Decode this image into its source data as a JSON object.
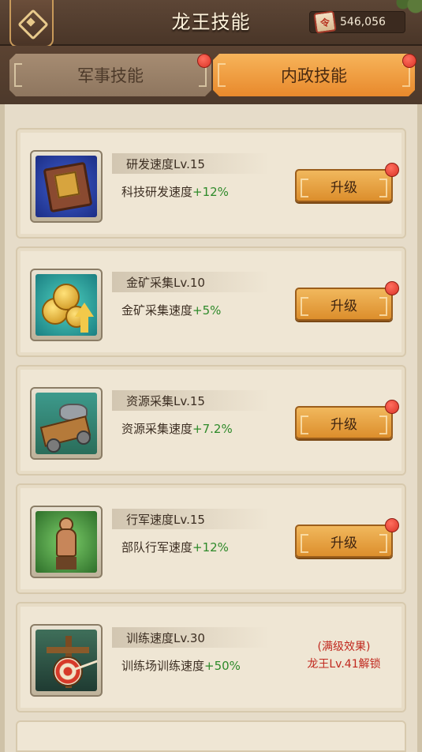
{
  "header": {
    "title": "龙王技能",
    "currency_amount": "546,056",
    "currency_icon_glyph": "令"
  },
  "tabs": [
    {
      "label": "军事技能",
      "active": false,
      "has_notification": true
    },
    {
      "label": "内政技能",
      "active": true,
      "has_notification": true
    }
  ],
  "skills": [
    {
      "name": "研发速度Lv.15",
      "desc_prefix": "科技研发速度",
      "bonus": "+12%",
      "icon": "research-book-icon",
      "button_label": "升级",
      "has_notification": true
    },
    {
      "name": "金矿采集Lv.10",
      "desc_prefix": "金矿采集速度",
      "bonus": "+5%",
      "icon": "gold-coins-icon",
      "button_label": "升级",
      "has_notification": true
    },
    {
      "name": "资源采集Lv.15",
      "desc_prefix": "资源采集速度",
      "bonus": "+7.2%",
      "icon": "mine-cart-icon",
      "button_label": "升级",
      "has_notification": true
    },
    {
      "name": "行军速度Lv.15",
      "desc_prefix": "部队行军速度",
      "bonus": "+12%",
      "icon": "marching-warrior-icon",
      "button_label": "升级",
      "has_notification": true
    },
    {
      "name": "训练速度Lv.30",
      "desc_prefix": "训练场训练速度",
      "bonus": "+50%",
      "icon": "training-target-icon",
      "locked_line1": "(满级效果)",
      "locked_line2": "龙王Lv.41解锁"
    }
  ],
  "colors": {
    "header_bg": "#4a3628",
    "active_tab": "#e8892c",
    "inactive_tab": "#8e765f",
    "bonus_green": "#2e8a2a",
    "locked_red": "#c0281e",
    "notification_red": "#d93326"
  }
}
